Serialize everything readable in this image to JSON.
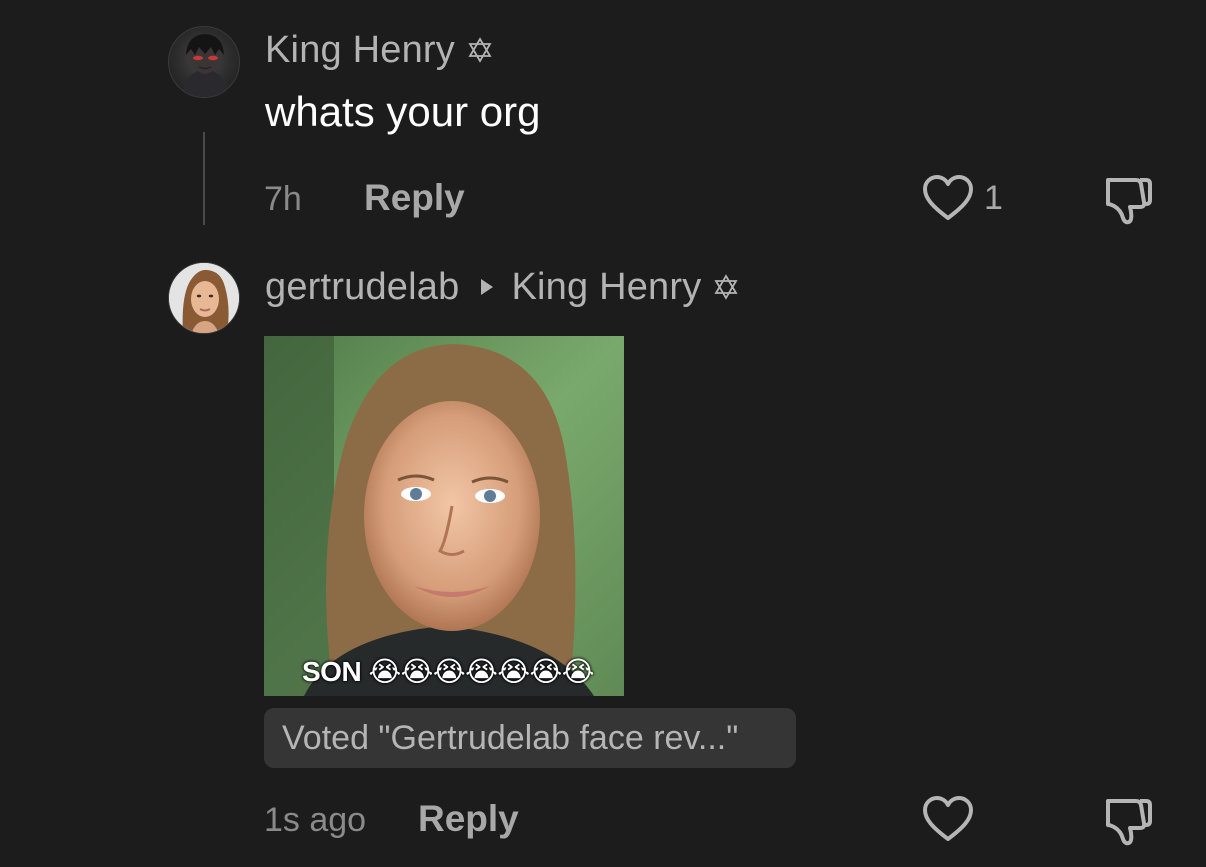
{
  "comments": [
    {
      "username": "King Henry",
      "text": "whats your org",
      "time": "7h",
      "reply_label": "Reply",
      "likes": "1"
    },
    {
      "username": "gertrudelab",
      "reply_to": "King Henry",
      "image_caption": "SON 😭😭😭😭😭😭😭",
      "vote_label": "Voted \"Gertrudelab face rev...\"",
      "time": "1s ago",
      "reply_label": "Reply"
    }
  ],
  "icons": {
    "badge": "star-of-david-icon",
    "reply_arrow": "triangle-right-icon",
    "like": "heart-outline-icon",
    "dislike": "thumbs-down-outline-icon"
  },
  "colors": {
    "background": "#1c1c1c",
    "username": "#b3b3b3",
    "text": "#ffffff",
    "muted": "#8a8a8a",
    "pill": "#353535"
  }
}
